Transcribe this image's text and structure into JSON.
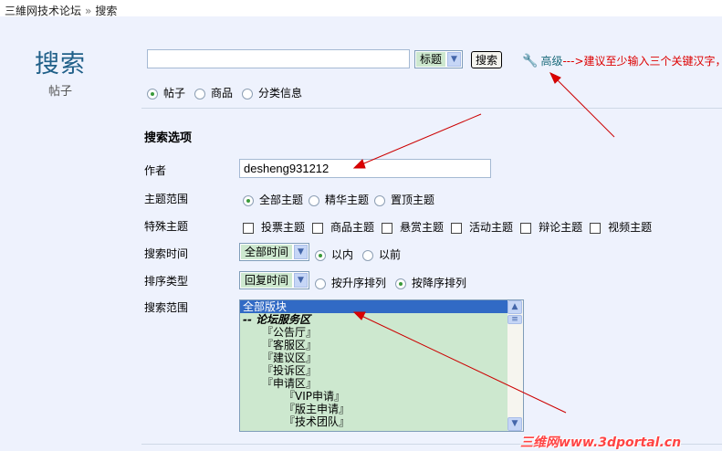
{
  "breadcrumb": {
    "home": "三維网技术论坛",
    "sep": "»",
    "current": "搜索"
  },
  "sidebar": {
    "title": "搜索",
    "subtitle": "帖子"
  },
  "search": {
    "query": "",
    "field_select": "标题",
    "button": "搜索",
    "advanced": "高级",
    "hint": "--->建议至少输入三个关键汉字，",
    "types": [
      {
        "label": "帖子",
        "checked": true
      },
      {
        "label": "商品",
        "checked": false
      },
      {
        "label": "分类信息",
        "checked": false
      }
    ]
  },
  "options": {
    "heading": "搜索选项",
    "author_label": "作者",
    "author_value": "desheng931212",
    "scope_label": "主题范围",
    "scope": [
      {
        "label": "全部主题",
        "checked": true
      },
      {
        "label": "精华主题",
        "checked": false
      },
      {
        "label": "置顶主题",
        "checked": false
      }
    ],
    "special_label": "特殊主题",
    "special": [
      "投票主题",
      "商品主题",
      "悬赏主题",
      "活动主题",
      "辩论主题",
      "视频主题"
    ],
    "time_label": "搜索时间",
    "time_select": "全部时间",
    "time_dir": [
      {
        "label": "以内",
        "checked": true
      },
      {
        "label": "以前",
        "checked": false
      }
    ],
    "order_label": "排序类型",
    "order_select": "回复时间",
    "order_dir": [
      {
        "label": "按升序排列",
        "checked": false
      },
      {
        "label": "按降序排列",
        "checked": true
      }
    ],
    "forum_label": "搜索范围",
    "forums": [
      {
        "label": "全部版块",
        "type": "selected"
      },
      {
        "label": "-- 论坛服务区",
        "type": "cat"
      },
      {
        "label": "『公告厅』",
        "type": "l1"
      },
      {
        "label": "『客服区』",
        "type": "l1"
      },
      {
        "label": "『建议区』",
        "type": "l1"
      },
      {
        "label": "『投诉区』",
        "type": "l1"
      },
      {
        "label": "『申请区』",
        "type": "l1"
      },
      {
        "label": "『VIP申请』",
        "type": "l2"
      },
      {
        "label": "『版主申请』",
        "type": "l2"
      },
      {
        "label": "『技术团队』",
        "type": "l2"
      }
    ]
  },
  "watermark": "三维网www.3dportal.cn",
  "colors": {
    "annotation": "#dd0000",
    "title": "#1f5f88",
    "list_bg": "#cde8cf",
    "selected": "#316ac5"
  }
}
